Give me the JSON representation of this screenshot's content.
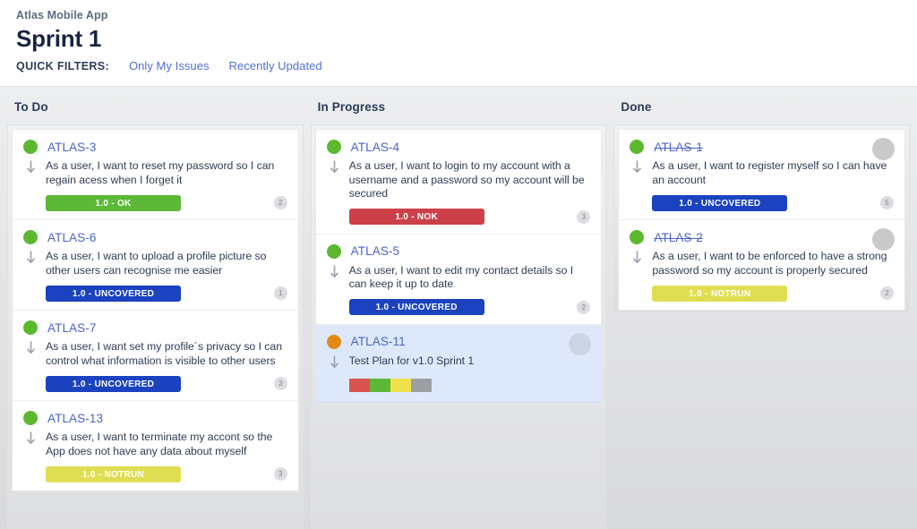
{
  "header": {
    "project_name": "Atlas Mobile App",
    "sprint_title": "Sprint 1",
    "quick_filters_label": "QUICK FILTERS:",
    "quick_filters": [
      {
        "label": "Only My Issues"
      },
      {
        "label": "Recently Updated"
      }
    ]
  },
  "colors": {
    "accent_link": "#4f6fd6",
    "issue_key": "#4a63c6",
    "status_ok": "#5cb836",
    "status_nok": "#cc4049",
    "status_uncovered": "#1b43bf",
    "status_notrun": "#dfde52",
    "story_dot": "#5cb82f",
    "test_dot": "#e08a15",
    "selected_card": "#dde8fa"
  },
  "board": {
    "columns": [
      {
        "title": "To Do",
        "overflows": true,
        "cards": [
          {
            "key": "ATLAS-3",
            "dot": "green",
            "struck": false,
            "selected": false,
            "avatar": false,
            "summary": "As a user, I want to reset my password so I can regain acess when I forget it",
            "priority_icon": "arrow-down-icon",
            "badge": {
              "label": "1.0 - OK",
              "style": "ok"
            },
            "count": "2"
          },
          {
            "key": "ATLAS-6",
            "dot": "green",
            "struck": false,
            "selected": false,
            "avatar": false,
            "summary": "As a user, I want to upload a profile picture so other users can recognise me easier",
            "priority_icon": "arrow-down-icon",
            "badge": {
              "label": "1.0 - UNCOVERED",
              "style": "uncovered"
            },
            "count": "1"
          },
          {
            "key": "ATLAS-7",
            "dot": "green",
            "struck": false,
            "selected": false,
            "avatar": false,
            "summary": "As a user, I want set my profile´s privacy so I can control what information is visible to other users",
            "priority_icon": "arrow-down-icon",
            "badge": {
              "label": "1.0 - UNCOVERED",
              "style": "uncovered"
            },
            "count": "3"
          },
          {
            "key": "ATLAS-13",
            "dot": "green",
            "struck": false,
            "selected": false,
            "avatar": false,
            "summary": "As a user, I want to terminate my accont so the App does not have any data about myself",
            "priority_icon": "arrow-down-icon",
            "badge": {
              "label": "1.0 - NOTRUN",
              "style": "notrun"
            },
            "count": "3"
          }
        ]
      },
      {
        "title": "In Progress",
        "overflows": true,
        "cards": [
          {
            "key": "ATLAS-4",
            "dot": "green",
            "struck": false,
            "selected": false,
            "avatar": false,
            "summary": "As a user, I want to login to my account with a username and a password so my account will be secured",
            "priority_icon": "arrow-down-icon",
            "badge": {
              "label": "1.0 - NOK",
              "style": "nok"
            },
            "count": "3"
          },
          {
            "key": "ATLAS-5",
            "dot": "green",
            "struck": false,
            "selected": false,
            "avatar": false,
            "summary": "As a user, I want to edit my contact details so I can keep it up to date",
            "priority_icon": "arrow-down-icon",
            "badge": {
              "label": "1.0 - UNCOVERED",
              "style": "uncovered"
            },
            "count": "2"
          },
          {
            "key": "ATLAS-11",
            "dot": "orange",
            "struck": false,
            "selected": true,
            "avatar": true,
            "summary": "Test Plan for v1.0 Sprint 1",
            "priority_icon": "arrow-down-icon",
            "segments": [
              "#d9534f",
              "#5cb836",
              "#f0e14a",
              "#9b9fa3"
            ],
            "count": ""
          }
        ]
      },
      {
        "title": "Done",
        "overflows": false,
        "cards": [
          {
            "key": "ATLAS-1",
            "dot": "green",
            "struck": true,
            "selected": false,
            "avatar": true,
            "summary": "As a user, I want to register myself so I can have an account",
            "priority_icon": "arrow-down-icon",
            "badge": {
              "label": "1.0 - UNCOVERED",
              "style": "uncovered"
            },
            "count": "5"
          },
          {
            "key": "ATLAS-2",
            "dot": "green",
            "struck": true,
            "selected": false,
            "avatar": true,
            "summary": "As a user, I want to be enforced to have a strong password so my account is properly secured",
            "priority_icon": "arrow-down-icon",
            "badge": {
              "label": "1.0 - NOTRUN",
              "style": "notrun"
            },
            "count": "2"
          }
        ]
      }
    ]
  }
}
